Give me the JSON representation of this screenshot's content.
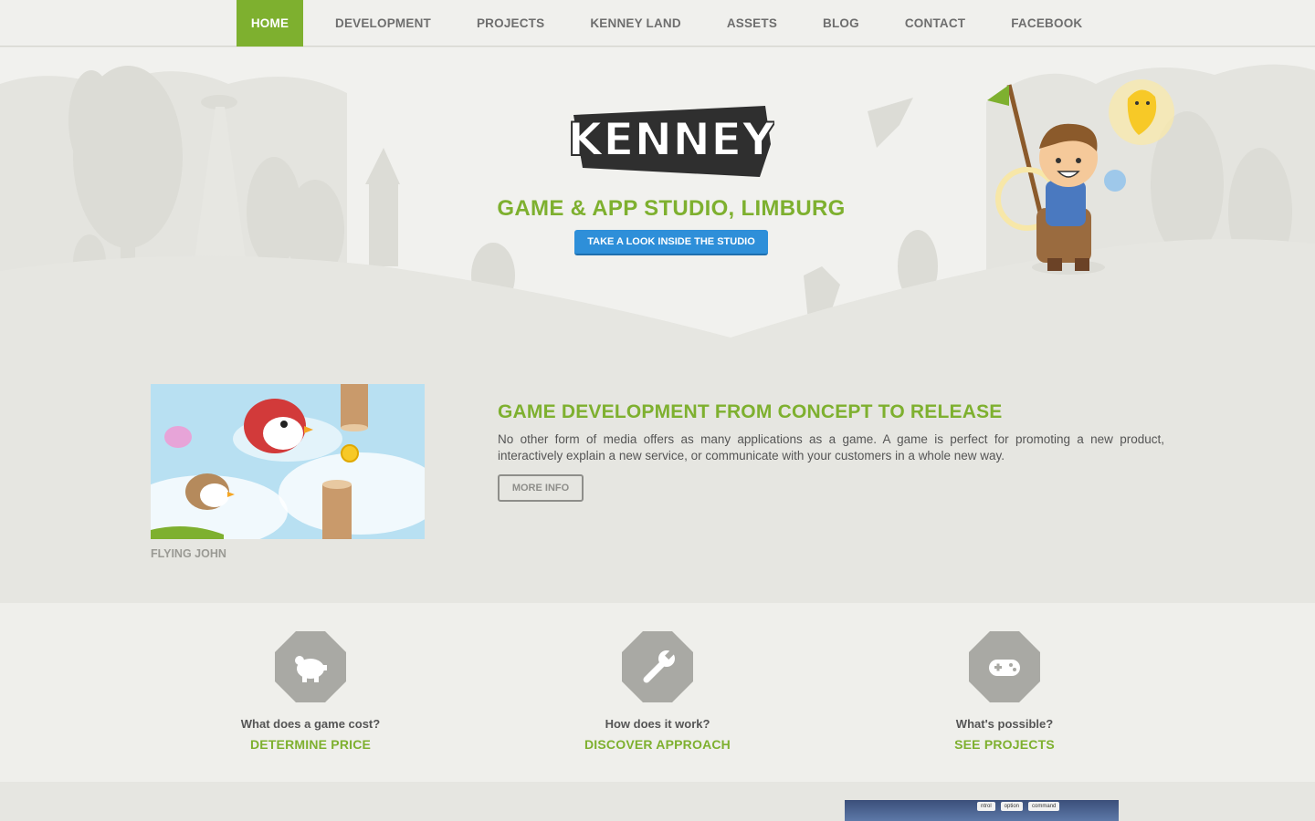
{
  "nav": {
    "items": [
      {
        "label": "HOME",
        "active": true
      },
      {
        "label": "DEVELOPMENT",
        "active": false
      },
      {
        "label": "PROJECTS",
        "active": false
      },
      {
        "label": "KENNEY LAND",
        "active": false
      },
      {
        "label": "ASSETS",
        "active": false
      },
      {
        "label": "BLOG",
        "active": false
      },
      {
        "label": "CONTACT",
        "active": false
      },
      {
        "label": "FACEBOOK",
        "active": false
      }
    ]
  },
  "hero": {
    "logo_text": "KENNEY",
    "tagline": "GAME & APP STUDIO, LIMBURG",
    "button_label": "TAKE A LOOK INSIDE THE STUDIO"
  },
  "feature": {
    "image_caption": "FLYING JOHN",
    "title": "GAME DEVELOPMENT FROM CONCEPT TO RELEASE",
    "body": "No other form of media offers as many applications as a game. A game is perfect for promoting a new product, interactively explain a new service, or communicate with your customers in a whole new way.",
    "more_label": "MORE INFO"
  },
  "services": [
    {
      "icon": "piggy-bank-icon",
      "question": "What does a game cost?",
      "link": "DETERMINE PRICE"
    },
    {
      "icon": "wrench-icon",
      "question": "How does it work?",
      "link": "DISCOVER APPROACH"
    },
    {
      "icon": "gamepad-icon",
      "question": "What's possible?",
      "link": "SEE PROJECTS"
    }
  ],
  "bottom_image": {
    "keys": [
      "ntrol",
      "option",
      "command"
    ]
  },
  "colors": {
    "accent_green": "#7eb02f",
    "button_blue": "#2e8fd9",
    "icon_grey": "#a9a9a4"
  }
}
